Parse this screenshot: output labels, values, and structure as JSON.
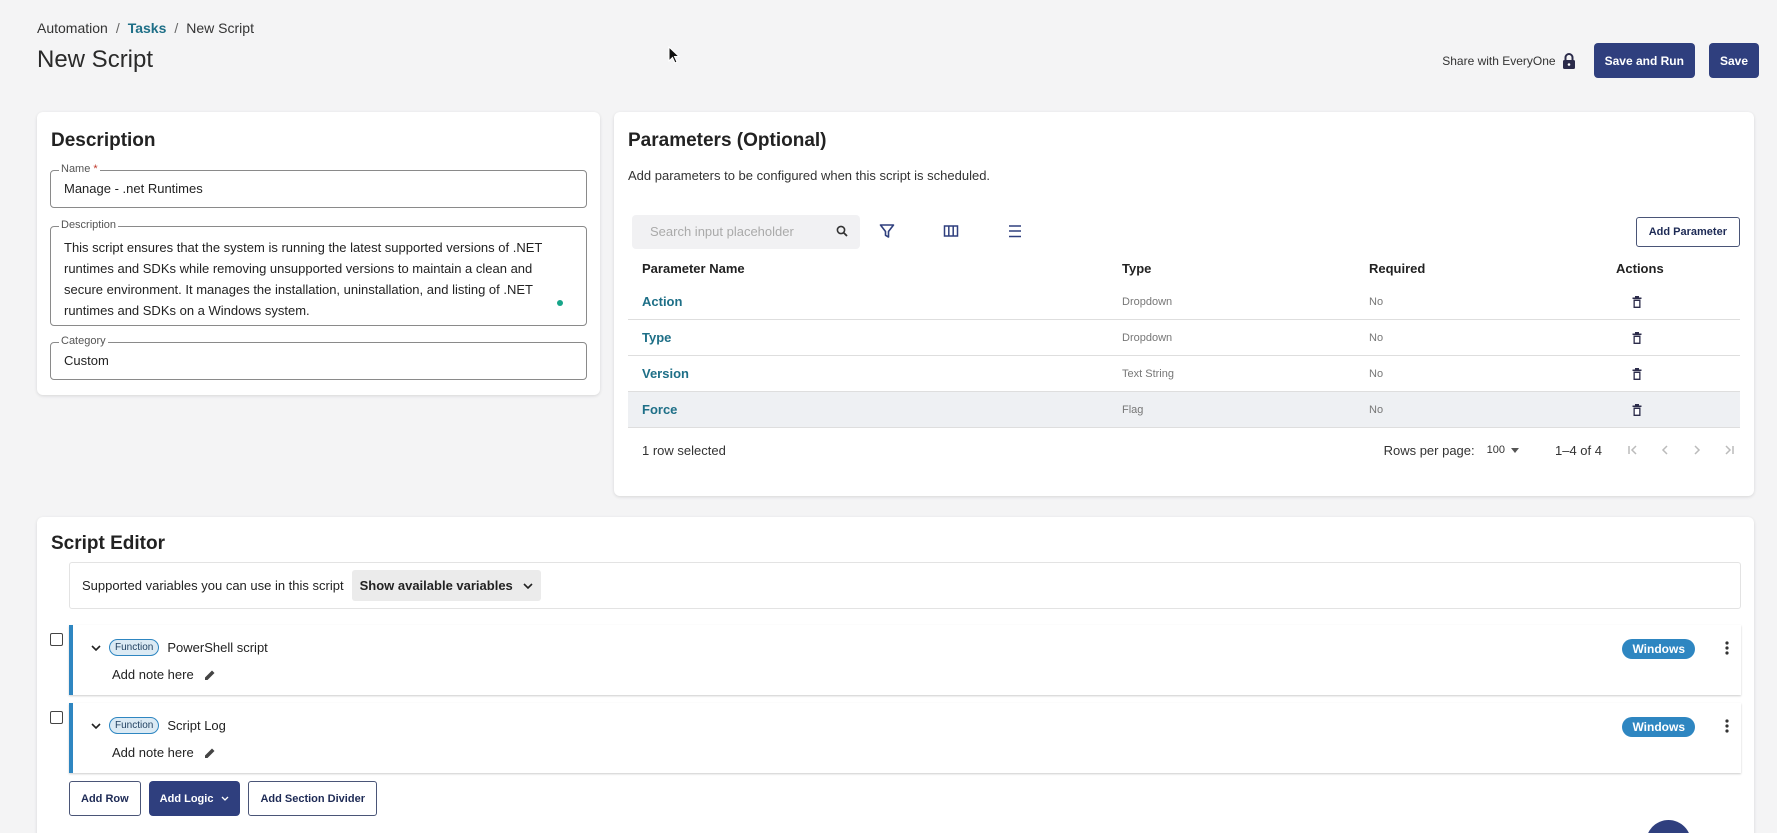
{
  "breadcrumb": {
    "root": "Automation",
    "sep1": "/",
    "tasks": "Tasks",
    "sep2": "/",
    "current": "New Script"
  },
  "page": {
    "title": "New Script"
  },
  "header": {
    "share_label": "Share with EveryOne",
    "save_run_label": "Save and Run",
    "save_label": "Save"
  },
  "description_card": {
    "title": "Description",
    "name_label": "Name",
    "name_required_mark": "*",
    "name_value": "Manage - .net Runtimes",
    "description_label": "Description",
    "description_lines": [
      "This script ensures that the system is running the latest supported versions of .NET",
      "runtimes and SDKs while removing unsupported versions to maintain a clean and",
      "secure environment. It manages the installation, uninstallation, and listing of .NET",
      "runtimes and SDKs on a Windows system."
    ],
    "category_label": "Category",
    "category_value": "Custom"
  },
  "parameters": {
    "title": "Parameters (Optional)",
    "subtitle": "Add parameters to be configured when this script is scheduled.",
    "search_placeholder": "Search input placeholder",
    "add_button": "Add Parameter",
    "columns": [
      "Parameter Name",
      "Type",
      "Required",
      "Actions"
    ],
    "rows": [
      {
        "name": "Action",
        "type": "Dropdown",
        "required": "No"
      },
      {
        "name": "Type",
        "type": "Dropdown",
        "required": "No"
      },
      {
        "name": "Version",
        "type": "Text String",
        "required": "No"
      },
      {
        "name": "Force",
        "type": "Flag",
        "required": "No"
      }
    ],
    "selected_row": 3,
    "selection_text": "1 row selected",
    "rows_per_page_label": "Rows per page:",
    "rows_per_page_value": "100",
    "range_text": "1–4 of 4"
  },
  "script_editor": {
    "title": "Script Editor",
    "vars_text": "Supported variables you can use in this script",
    "vars_button": "Show available variables",
    "blocks": [
      {
        "badge": "Function",
        "name": "PowerShell script",
        "note": "Add note here",
        "os": "Windows"
      },
      {
        "badge": "Function",
        "name": "Script Log",
        "note": "Add note here",
        "os": "Windows"
      }
    ],
    "add_row": "Add Row",
    "add_logic": "Add Logic",
    "add_divider": "Add Section Divider"
  },
  "colors": {
    "primary": "#2f3f7e",
    "link": "#1e6f87",
    "badge": "#2e86c1"
  },
  "icons": [
    "lock-icon",
    "search-icon",
    "filter-icon",
    "columns-icon",
    "density-icon",
    "trash-icon",
    "chevron-down-icon",
    "pencil-icon",
    "kebab-icon",
    "first-page-icon",
    "prev-page-icon",
    "next-page-icon",
    "last-page-icon"
  ]
}
